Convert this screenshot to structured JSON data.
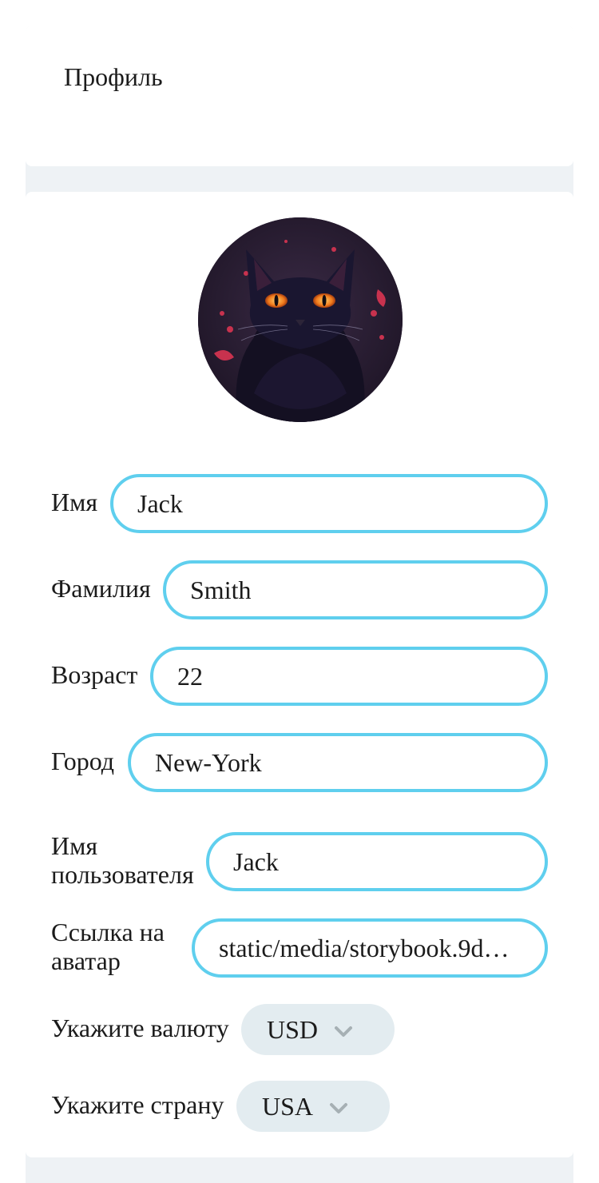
{
  "header": {
    "title": "Профиль"
  },
  "profile": {
    "avatar_alt": "cat-avatar",
    "fields": [
      {
        "label": "Имя",
        "value": "Jack"
      },
      {
        "label": "Фамилия",
        "value": "Smith"
      },
      {
        "label": "Возраст",
        "value": "22"
      },
      {
        "label": "Город",
        "value": "New-York"
      },
      {
        "label": "Имя пользователя",
        "value": "Jack"
      },
      {
        "label": "Ссылка на аватар",
        "value": "static/media/storybook.9d…"
      }
    ],
    "currency": {
      "label": "Укажите валюту",
      "value": "USD"
    },
    "country": {
      "label": "Укажите страну",
      "value": "USA"
    }
  },
  "colors": {
    "page_bg": "#eef2f5",
    "card_bg": "#ffffff",
    "input_border": "#5fcfee",
    "select_bg": "#e3ecf0",
    "chevron": "#a6b0b4"
  }
}
